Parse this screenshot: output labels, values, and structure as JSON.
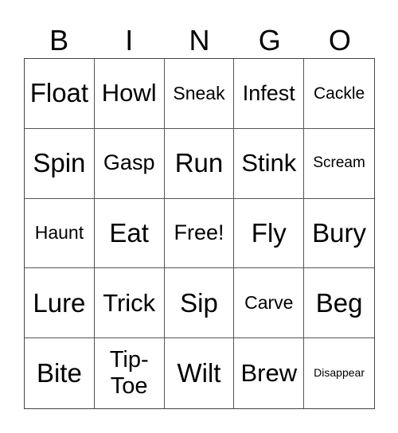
{
  "header": [
    "B",
    "I",
    "N",
    "G",
    "O"
  ],
  "cells": [
    [
      "Float",
      "Howl",
      "Sneak",
      "Infest",
      "Cackle"
    ],
    [
      "Spin",
      "Gasp",
      "Run",
      "Stink",
      "Scream"
    ],
    [
      "Haunt",
      "Eat",
      "Free!",
      "Fly",
      "Bury"
    ],
    [
      "Lure",
      "Trick",
      "Sip",
      "Carve",
      "Beg"
    ],
    [
      "Bite",
      "Tip-\nToe",
      "Wilt",
      "Brew",
      "Disappear"
    ]
  ]
}
